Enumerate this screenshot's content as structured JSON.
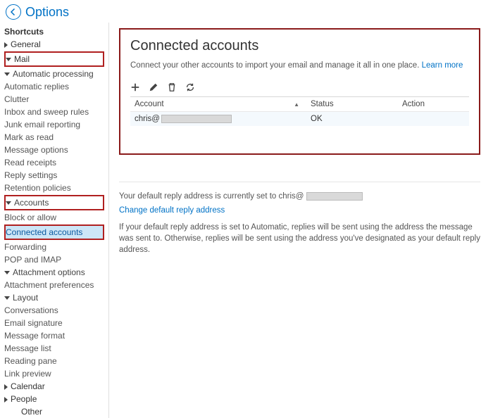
{
  "header": {
    "title": "Options"
  },
  "sidebar": {
    "shortcuts": "Shortcuts",
    "general": "General",
    "mail": "Mail",
    "auto_proc": "Automatic processing",
    "auto_replies": "Automatic replies",
    "clutter": "Clutter",
    "inbox_rules": "Inbox and sweep rules",
    "junk_report": "Junk email reporting",
    "mark_read": "Mark as read",
    "msg_options": "Message options",
    "read_receipts": "Read receipts",
    "reply_settings": "Reply settings",
    "retention": "Retention policies",
    "accounts": "Accounts",
    "block_allow": "Block or allow",
    "connected": "Connected accounts",
    "forwarding": "Forwarding",
    "pop_imap": "POP and IMAP",
    "attach_opts": "Attachment options",
    "attach_prefs": "Attachment preferences",
    "layout": "Layout",
    "conversations": "Conversations",
    "email_sig": "Email signature",
    "msg_format": "Message format",
    "msg_list": "Message list",
    "reading_pane": "Reading pane",
    "link_preview": "Link preview",
    "calendar": "Calendar",
    "people": "People",
    "other": "Other"
  },
  "panel": {
    "title": "Connected accounts",
    "desc": "Connect your other accounts to import your email and manage it all in one place. ",
    "learn_more": "Learn more"
  },
  "table": {
    "col_account": "Account",
    "col_status": "Status",
    "col_action": "Action",
    "row_prefix": "chris@",
    "row_status": "OK"
  },
  "reply": {
    "line_prefix": "Your default reply address is currently set to chris@",
    "change_link": "Change default reply address",
    "note": "If your default reply address is set to Automatic, replies will be sent using the address the message was sent to. Otherwise, replies will be sent using the address you've designated as your default reply address."
  }
}
